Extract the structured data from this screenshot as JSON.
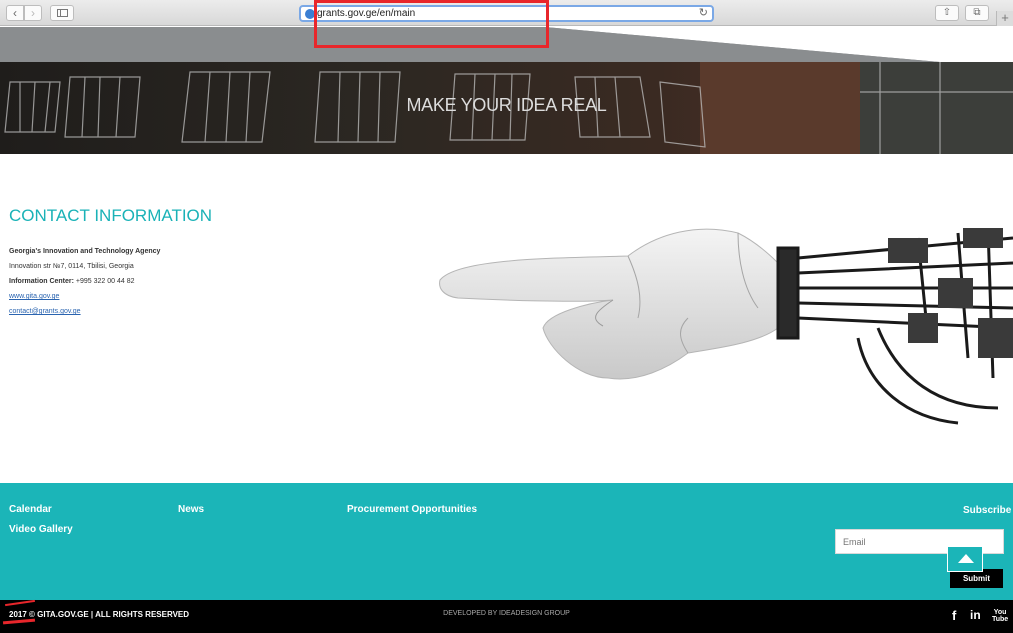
{
  "browser": {
    "url": "grants.gov.ge/en/main",
    "back_glyph": "‹",
    "forward_glyph": "›",
    "reload_glyph": "↻",
    "share_glyph": "⇧",
    "tabs_glyph": "⧉",
    "newtab_glyph": "+"
  },
  "hero": {
    "title": "MAKE YOUR IDEA REAL"
  },
  "contact": {
    "title": "CONTACT INFORMATION",
    "agency": "Georgia's Innovation and Technology Agency",
    "address": "Innovation str №7, 0114, Tbilisi, Georgia",
    "info_label": "Information Center:",
    "info_phone": "+995 322 00 44 82",
    "website": "www.gita.gov.ge",
    "email": "contact@grants.gov.ge"
  },
  "footer": {
    "links": [
      "Calendar",
      "News",
      "Procurement Opportunities",
      "Video Gallery"
    ],
    "subscribe_label": "Subscribe",
    "email_placeholder": "Email",
    "submit_label": "Submit"
  },
  "bottom": {
    "copyright": "2017 © GITA.GOV.GE | ALL RIGHTS RESERVED",
    "developer": "DEVELOPED BY IDEADESIGN GROUP",
    "social": {
      "facebook": "f",
      "linkedin": "in",
      "youtube_top": "You",
      "youtube_bottom": "Tube"
    }
  },
  "colors": {
    "accent": "#1bb5b8",
    "highlight": "#e8262b"
  },
  "icons": [
    "globe-icon",
    "reload-icon",
    "share-icon",
    "tabs-icon",
    "sidebar-icon",
    "chevron-up-icon",
    "facebook-icon",
    "linkedin-icon",
    "youtube-icon"
  ]
}
